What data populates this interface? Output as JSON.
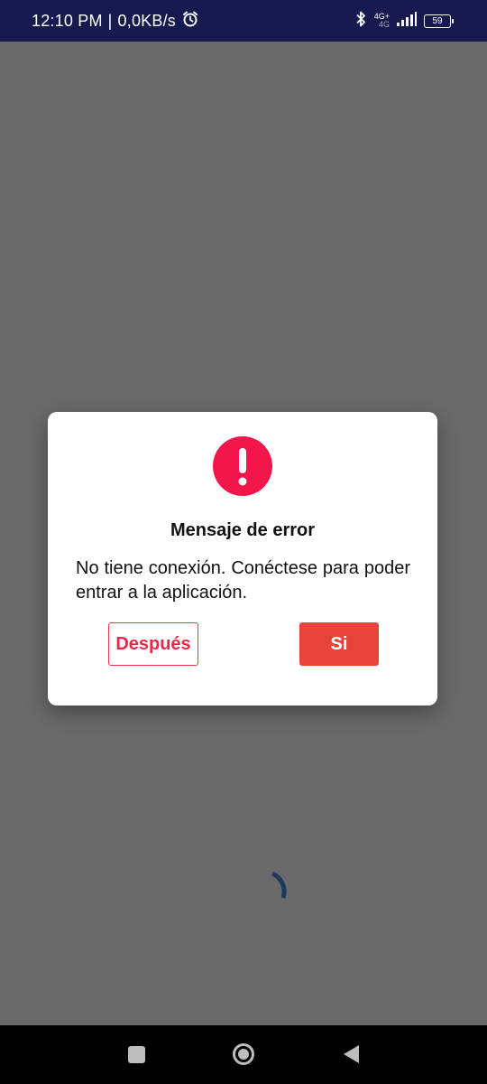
{
  "status_bar": {
    "time": "12:10 PM",
    "separator": "|",
    "net_speed": "0,0KB/s",
    "network_type": "4G+",
    "network_sub": "4G",
    "battery": "59",
    "icons": [
      "alarm-icon",
      "bluetooth-icon",
      "signal-icon",
      "battery-icon"
    ]
  },
  "dialog": {
    "title": "Mensaje de error",
    "message": "No tiene conexión. Conéctese para poder entrar a la aplicación.",
    "later_label": "Después",
    "yes_label": "Si",
    "accent_color": "#e8294a",
    "yes_color": "#e6443b",
    "icon": "error-alert-icon"
  },
  "nav_bar": {
    "icons": [
      "recent-apps-icon",
      "home-icon",
      "back-icon"
    ]
  }
}
